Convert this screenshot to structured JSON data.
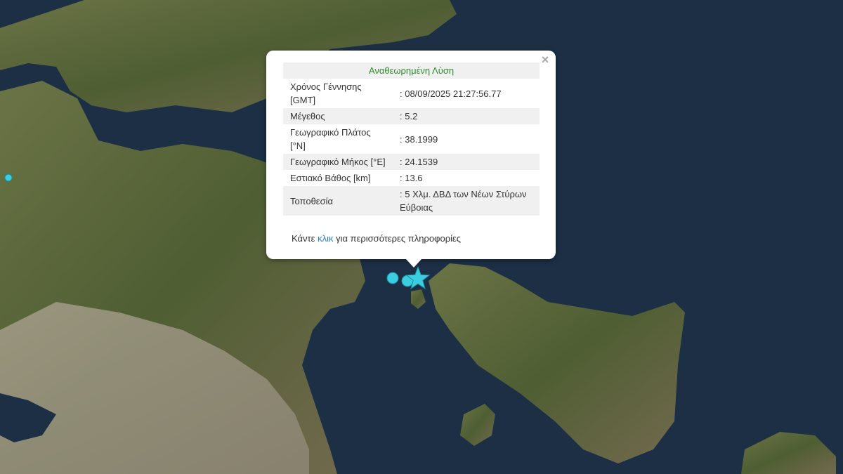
{
  "popup": {
    "title": "Αναθεωρημένη Λύση",
    "rows": [
      {
        "label": "Χρόνος Γέννησης [GMT]",
        "value": ": 08/09/2025 21:27:56.77"
      },
      {
        "label": "Μέγεθος",
        "value": ": 5.2"
      },
      {
        "label": "Γεωγραφικό Πλάτος [°N]",
        "value": ": 38.1999"
      },
      {
        "label": "Γεωγραφικό Μήκος [°E]",
        "value": ": 24.1539"
      },
      {
        "label": "Εστιακό Βάθος [km]",
        "value": ": 13.6"
      },
      {
        "label": "Τοποθεσία",
        "value": ": 5 Χλμ. ΔΒΔ των Νέων Στύρων Εύβοιας"
      }
    ],
    "more": {
      "before": "Κάντε ",
      "link": "κλικ",
      "after": " για περισσότερες πληροφορίες"
    },
    "close_glyph": "×"
  },
  "markers": {
    "epicenter_icon": "star-icon",
    "event_icon": "circle-icon",
    "color": "#3ccde0"
  },
  "colors": {
    "sea": "#1c2f45",
    "land": "#5b6a3a",
    "urban": "#9a9482",
    "title_green": "#2e8b2e",
    "link_blue": "#2a7ec8"
  }
}
